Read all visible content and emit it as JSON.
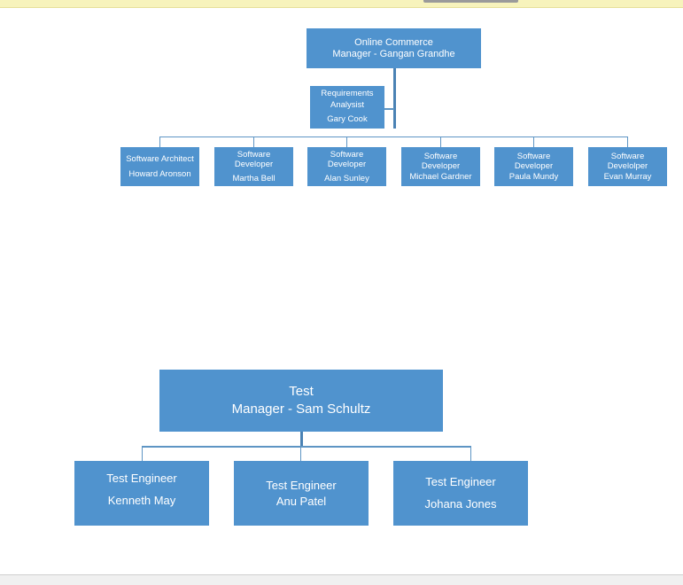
{
  "document": {
    "type": "organization-chart",
    "theme_color": "#5093ce",
    "connector_color": "#4a82b4"
  },
  "chrome": {
    "top_band_color": "#f7f3bc",
    "top_bar_color": "#9a9a9a",
    "footer_color": "#f0f0f0"
  },
  "org": {
    "engineering": {
      "root": {
        "title": "Online Commerce",
        "person": "Manager - Gangan Grandhe"
      },
      "staff": {
        "title_line1": "Requirements",
        "title_line2": "Analysist",
        "person": "Gary Cook"
      },
      "reports": [
        {
          "title_line1": "Software Architect",
          "title_line2": "",
          "person": "Howard Aronson"
        },
        {
          "title_line1": "Software",
          "title_line2": "Developer",
          "person": "Martha Bell"
        },
        {
          "title_line1": "Software",
          "title_line2": "Developer",
          "person": "Alan Sunley"
        },
        {
          "title_line1": "Software",
          "title_line2": "Developer",
          "person": "Michael Gardner"
        },
        {
          "title_line1": "Software",
          "title_line2": "Developer",
          "person": "Paula Mundy"
        },
        {
          "title_line1": "Software",
          "title_line2": "Develolper",
          "person": "Evan Murray"
        }
      ]
    },
    "test": {
      "root": {
        "title": "Test",
        "person": "Manager - Sam Schultz"
      },
      "reports": [
        {
          "title": "Test Engineer",
          "person": "Kenneth May"
        },
        {
          "title": "Test Engineer",
          "person": "Anu Patel"
        },
        {
          "title": "Test Engineer",
          "person": "Johana Jones"
        }
      ]
    }
  }
}
